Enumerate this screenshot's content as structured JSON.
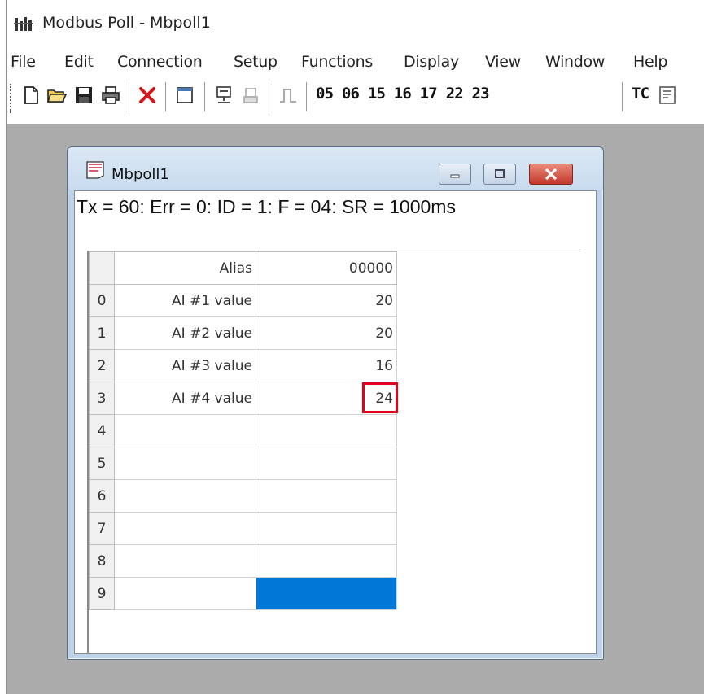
{
  "app": {
    "title": "Modbus Poll - Mbpoll1",
    "icon": "modbus-poll-app-icon"
  },
  "menu": [
    "File",
    "Edit",
    "Connection",
    "Setup",
    "Functions",
    "Display",
    "View",
    "Window",
    "Help"
  ],
  "toolbar": {
    "icons": [
      "new-document-icon",
      "open-folder-icon",
      "save-icon",
      "print-icon",
      "close-red-x-icon",
      "window-icon",
      "connect-icon",
      "disconnect-icon",
      "pulse-icon",
      "test-center-icon"
    ],
    "function_codes": "05 06 15 16 17 22 23",
    "tc_label": "TC"
  },
  "child_window": {
    "title": "Mbpoll1",
    "icon": "document-icon",
    "status_line": "Tx = 60: Err = 0: ID = 1: F = 04: SR = 1000ms",
    "grid": {
      "headers": {
        "alias": "Alias",
        "address": "00000"
      },
      "rows": [
        {
          "num": "0",
          "alias": "AI #1 value",
          "value": "20"
        },
        {
          "num": "1",
          "alias": "AI #2 value",
          "value": "20"
        },
        {
          "num": "2",
          "alias": "AI #3 value",
          "value": "16"
        },
        {
          "num": "3",
          "alias": "AI #4 value",
          "value": "24"
        },
        {
          "num": "4",
          "alias": "",
          "value": ""
        },
        {
          "num": "5",
          "alias": "",
          "value": ""
        },
        {
          "num": "6",
          "alias": "",
          "value": ""
        },
        {
          "num": "7",
          "alias": "",
          "value": ""
        },
        {
          "num": "8",
          "alias": "",
          "value": ""
        },
        {
          "num": "9",
          "alias": "",
          "value": ""
        }
      ],
      "selected_row": 9,
      "highlighted_row": 3
    }
  },
  "colors": {
    "selection": "#0078d7",
    "highlight_box": "#e3001b",
    "workspace": "#ababab"
  }
}
